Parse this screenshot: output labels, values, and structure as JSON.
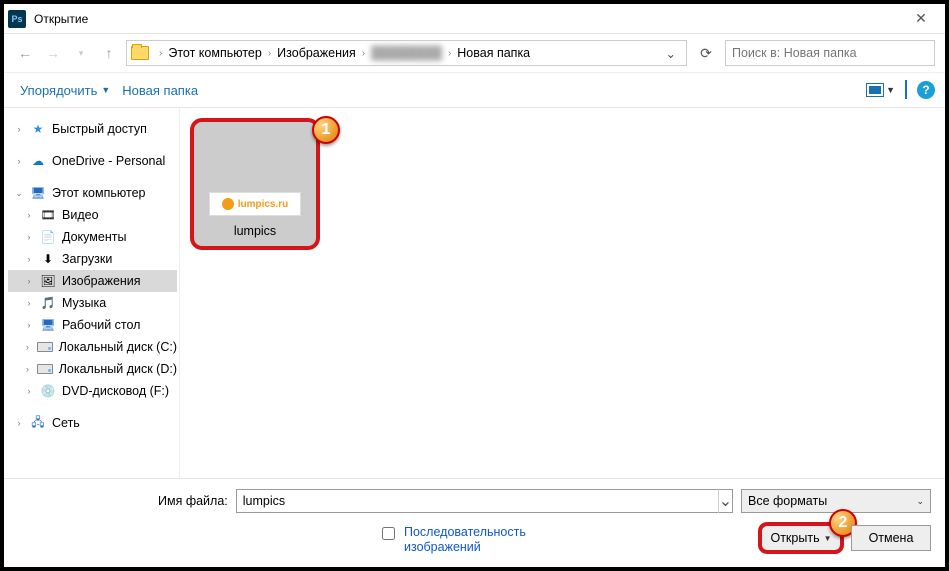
{
  "title": "Открытие",
  "breadcrumb": {
    "root": "Этот компьютер",
    "pictures": "Изображения",
    "hidden": "████████",
    "folder": "Новая папка"
  },
  "search_placeholder": "Поиск в: Новая папка",
  "toolbar": {
    "organize": "Упорядочить",
    "new_folder": "Новая папка"
  },
  "tree": {
    "quick": "Быстрый доступ",
    "onedrive": "OneDrive - Personal",
    "thispc": "Этот компьютер",
    "video": "Видео",
    "documents": "Документы",
    "downloads": "Загрузки",
    "pictures": "Изображения",
    "music": "Музыка",
    "desktop": "Рабочий стол",
    "diskc": "Локальный диск (C:)",
    "diskd": "Локальный диск (D:)",
    "dvd": "DVD-дисковод (F:)",
    "network": "Сеть"
  },
  "file": {
    "thumb_badge": "lumpics.ru",
    "thumb_name": "lumpics"
  },
  "footer": {
    "filename_label": "Имя файла:",
    "filename_value": "lumpics",
    "type_label": "Все форматы",
    "sequence": "Последовательность изображений",
    "open": "Открыть",
    "cancel": "Отмена"
  },
  "callouts": {
    "one": "1",
    "two": "2"
  }
}
